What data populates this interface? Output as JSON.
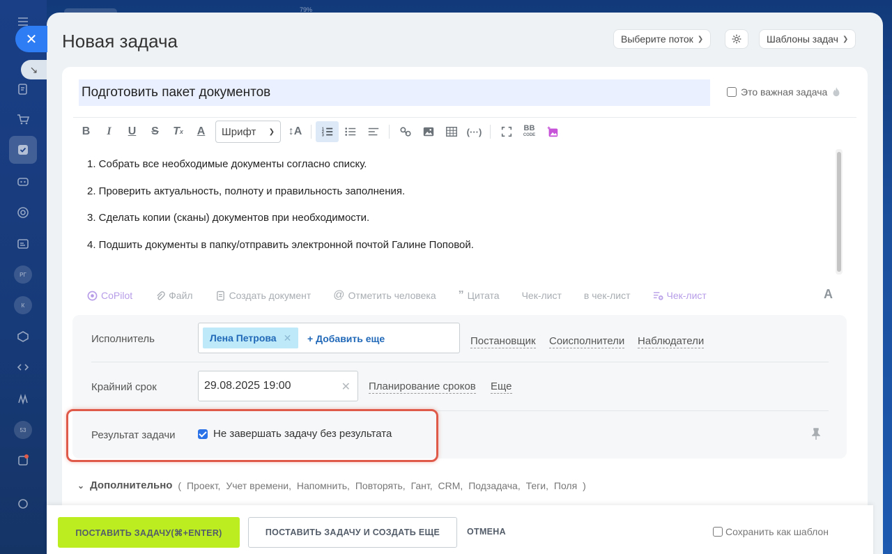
{
  "topbar": {
    "percent": "79%"
  },
  "panel": {
    "title": "Новая задача",
    "flow_select": "Выберите поток",
    "templates": "Шаблоны задач"
  },
  "task": {
    "title": "Подготовить пакет документов",
    "important_label": "Это важная задача",
    "description": [
      "1. Собрать все необходимые документы согласно списку.",
      "2. Проверить актуальность, полноту и правильность заполнения.",
      "3. Сделать копии (сканы) документов при необходимости.",
      "4. Подшить документы в папку/отправить электронной почтой Галине Поповой."
    ]
  },
  "toolbar": {
    "font_label": "Шрифт",
    "bb_label": "BB",
    "code_label": "CODE"
  },
  "bottom_tools": {
    "copilot": "CoPilot",
    "file": "Файл",
    "create_doc": "Создать документ",
    "mention": "Отметить человека",
    "quote": "Цитата",
    "checklist": "Чек-лист",
    "to_checklist": "в чек-лист",
    "checklist2": "Чек-лист",
    "text_format": "A"
  },
  "fields": {
    "assignee_label": "Исполнитель",
    "assignee_name": "Лена Петрова",
    "add_more": "+ Добавить еще",
    "creator": "Постановщик",
    "co_executors": "Соисполнители",
    "observers": "Наблюдатели",
    "deadline_label": "Крайний срок",
    "deadline_value": "29.08.2025 19:00",
    "planning": "Планирование сроков",
    "more": "Еще",
    "result_label": "Результат задачи",
    "result_check": "Не завершать задачу без результата"
  },
  "extra": {
    "label": "Дополнительно",
    "open_paren": "(",
    "items": [
      "Проект,",
      "Учет времени,",
      "Напомнить,",
      "Повторять,",
      "Гант,",
      "CRM,",
      "Подзадача,",
      "Теги,",
      "Поля"
    ],
    "close_paren": ")"
  },
  "footer": {
    "submit": "ПОСТАВИТЬ ЗАДАЧУ(⌘+ENTER)",
    "submit_and_new": "ПОСТАВИТЬ ЗАДАЧУ И СОЗДАТЬ ЕЩЕ",
    "cancel": "ОТМЕНА",
    "save_template": "Сохранить как шаблон"
  },
  "leftbar": {
    "rg": "РГ",
    "k": "К",
    "num": "53"
  },
  "colors": {
    "accent_green": "#bbed21",
    "highlight_red": "#e05a4a",
    "link_blue": "#2169b8",
    "title_bg": "#eaf0ff"
  }
}
